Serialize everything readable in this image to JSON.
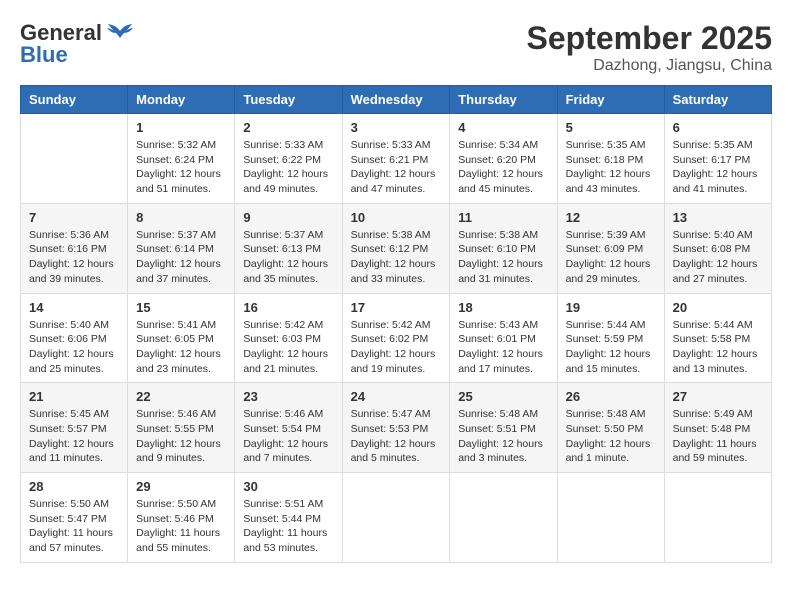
{
  "logo": {
    "line1": "General",
    "line2": "Blue"
  },
  "header": {
    "month": "September 2025",
    "location": "Dazhong, Jiangsu, China"
  },
  "weekdays": [
    "Sunday",
    "Monday",
    "Tuesday",
    "Wednesday",
    "Thursday",
    "Friday",
    "Saturday"
  ],
  "weeks": [
    [
      {
        "day": "",
        "info": ""
      },
      {
        "day": "1",
        "info": "Sunrise: 5:32 AM\nSunset: 6:24 PM\nDaylight: 12 hours\nand 51 minutes."
      },
      {
        "day": "2",
        "info": "Sunrise: 5:33 AM\nSunset: 6:22 PM\nDaylight: 12 hours\nand 49 minutes."
      },
      {
        "day": "3",
        "info": "Sunrise: 5:33 AM\nSunset: 6:21 PM\nDaylight: 12 hours\nand 47 minutes."
      },
      {
        "day": "4",
        "info": "Sunrise: 5:34 AM\nSunset: 6:20 PM\nDaylight: 12 hours\nand 45 minutes."
      },
      {
        "day": "5",
        "info": "Sunrise: 5:35 AM\nSunset: 6:18 PM\nDaylight: 12 hours\nand 43 minutes."
      },
      {
        "day": "6",
        "info": "Sunrise: 5:35 AM\nSunset: 6:17 PM\nDaylight: 12 hours\nand 41 minutes."
      }
    ],
    [
      {
        "day": "7",
        "info": "Sunrise: 5:36 AM\nSunset: 6:16 PM\nDaylight: 12 hours\nand 39 minutes."
      },
      {
        "day": "8",
        "info": "Sunrise: 5:37 AM\nSunset: 6:14 PM\nDaylight: 12 hours\nand 37 minutes."
      },
      {
        "day": "9",
        "info": "Sunrise: 5:37 AM\nSunset: 6:13 PM\nDaylight: 12 hours\nand 35 minutes."
      },
      {
        "day": "10",
        "info": "Sunrise: 5:38 AM\nSunset: 6:12 PM\nDaylight: 12 hours\nand 33 minutes."
      },
      {
        "day": "11",
        "info": "Sunrise: 5:38 AM\nSunset: 6:10 PM\nDaylight: 12 hours\nand 31 minutes."
      },
      {
        "day": "12",
        "info": "Sunrise: 5:39 AM\nSunset: 6:09 PM\nDaylight: 12 hours\nand 29 minutes."
      },
      {
        "day": "13",
        "info": "Sunrise: 5:40 AM\nSunset: 6:08 PM\nDaylight: 12 hours\nand 27 minutes."
      }
    ],
    [
      {
        "day": "14",
        "info": "Sunrise: 5:40 AM\nSunset: 6:06 PM\nDaylight: 12 hours\nand 25 minutes."
      },
      {
        "day": "15",
        "info": "Sunrise: 5:41 AM\nSunset: 6:05 PM\nDaylight: 12 hours\nand 23 minutes."
      },
      {
        "day": "16",
        "info": "Sunrise: 5:42 AM\nSunset: 6:03 PM\nDaylight: 12 hours\nand 21 minutes."
      },
      {
        "day": "17",
        "info": "Sunrise: 5:42 AM\nSunset: 6:02 PM\nDaylight: 12 hours\nand 19 minutes."
      },
      {
        "day": "18",
        "info": "Sunrise: 5:43 AM\nSunset: 6:01 PM\nDaylight: 12 hours\nand 17 minutes."
      },
      {
        "day": "19",
        "info": "Sunrise: 5:44 AM\nSunset: 5:59 PM\nDaylight: 12 hours\nand 15 minutes."
      },
      {
        "day": "20",
        "info": "Sunrise: 5:44 AM\nSunset: 5:58 PM\nDaylight: 12 hours\nand 13 minutes."
      }
    ],
    [
      {
        "day": "21",
        "info": "Sunrise: 5:45 AM\nSunset: 5:57 PM\nDaylight: 12 hours\nand 11 minutes."
      },
      {
        "day": "22",
        "info": "Sunrise: 5:46 AM\nSunset: 5:55 PM\nDaylight: 12 hours\nand 9 minutes."
      },
      {
        "day": "23",
        "info": "Sunrise: 5:46 AM\nSunset: 5:54 PM\nDaylight: 12 hours\nand 7 minutes."
      },
      {
        "day": "24",
        "info": "Sunrise: 5:47 AM\nSunset: 5:53 PM\nDaylight: 12 hours\nand 5 minutes."
      },
      {
        "day": "25",
        "info": "Sunrise: 5:48 AM\nSunset: 5:51 PM\nDaylight: 12 hours\nand 3 minutes."
      },
      {
        "day": "26",
        "info": "Sunrise: 5:48 AM\nSunset: 5:50 PM\nDaylight: 12 hours\nand 1 minute."
      },
      {
        "day": "27",
        "info": "Sunrise: 5:49 AM\nSunset: 5:48 PM\nDaylight: 11 hours\nand 59 minutes."
      }
    ],
    [
      {
        "day": "28",
        "info": "Sunrise: 5:50 AM\nSunset: 5:47 PM\nDaylight: 11 hours\nand 57 minutes."
      },
      {
        "day": "29",
        "info": "Sunrise: 5:50 AM\nSunset: 5:46 PM\nDaylight: 11 hours\nand 55 minutes."
      },
      {
        "day": "30",
        "info": "Sunrise: 5:51 AM\nSunset: 5:44 PM\nDaylight: 11 hours\nand 53 minutes."
      },
      {
        "day": "",
        "info": ""
      },
      {
        "day": "",
        "info": ""
      },
      {
        "day": "",
        "info": ""
      },
      {
        "day": "",
        "info": ""
      }
    ]
  ]
}
